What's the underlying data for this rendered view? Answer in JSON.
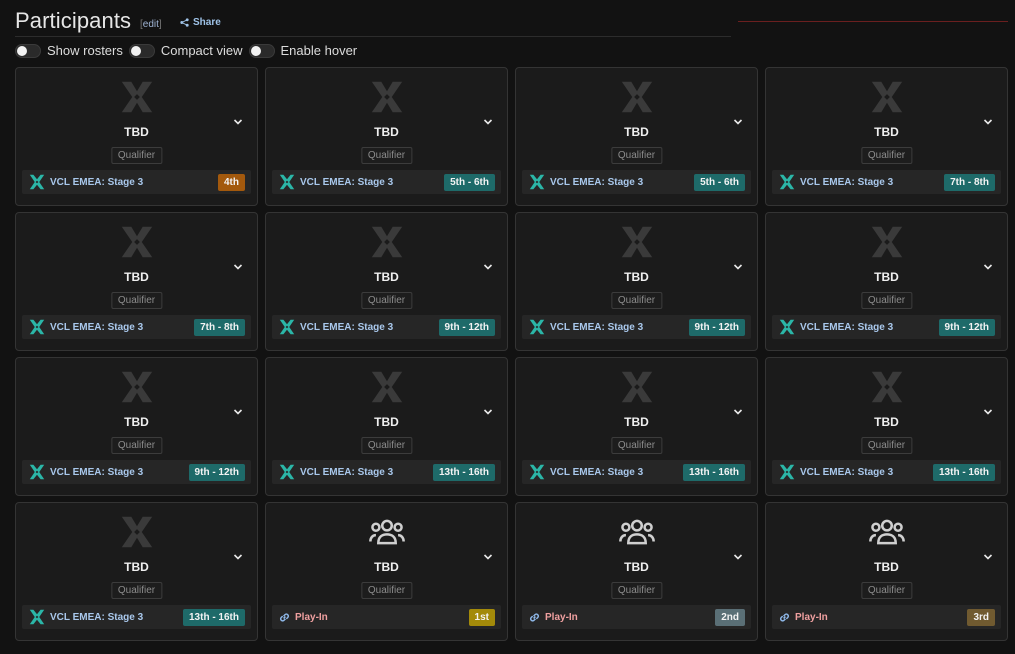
{
  "header": {
    "title": "Participants",
    "edit_label": "edit",
    "share_label": "Share"
  },
  "toggles": [
    {
      "label": "Show rosters"
    },
    {
      "label": "Compact view"
    },
    {
      "label": "Enable hover"
    }
  ],
  "colors": {
    "qualifier_logo": "#3a3a3a",
    "vcl_icon": "#2bb7a8",
    "place_4th": "#a3590d",
    "place_teal": "#1e6a69",
    "place_1st": "#a38a0a",
    "place_2nd": "#5a6f76",
    "place_3rd": "#705a30"
  },
  "cards": [
    {
      "name": "TBD",
      "tag": "Qualifier",
      "icon": "qualifier-logo-icon",
      "source": "VCL EMEA: Stage 3",
      "source_type": "vcl",
      "placement": "4th",
      "placement_color": "#a3590d"
    },
    {
      "name": "TBD",
      "tag": "Qualifier",
      "icon": "qualifier-logo-icon",
      "source": "VCL EMEA: Stage 3",
      "source_type": "vcl",
      "placement": "5th - 6th",
      "placement_color": "#1e6a69"
    },
    {
      "name": "TBD",
      "tag": "Qualifier",
      "icon": "qualifier-logo-icon",
      "source": "VCL EMEA: Stage 3",
      "source_type": "vcl",
      "placement": "5th - 6th",
      "placement_color": "#1e6a69"
    },
    {
      "name": "TBD",
      "tag": "Qualifier",
      "icon": "qualifier-logo-icon",
      "source": "VCL EMEA: Stage 3",
      "source_type": "vcl",
      "placement": "7th - 8th",
      "placement_color": "#1e6a69"
    },
    {
      "name": "TBD",
      "tag": "Qualifier",
      "icon": "qualifier-logo-icon",
      "source": "VCL EMEA: Stage 3",
      "source_type": "vcl",
      "placement": "7th - 8th",
      "placement_color": "#1e6a69"
    },
    {
      "name": "TBD",
      "tag": "Qualifier",
      "icon": "qualifier-logo-icon",
      "source": "VCL EMEA: Stage 3",
      "source_type": "vcl",
      "placement": "9th - 12th",
      "placement_color": "#1e6a69"
    },
    {
      "name": "TBD",
      "tag": "Qualifier",
      "icon": "qualifier-logo-icon",
      "source": "VCL EMEA: Stage 3",
      "source_type": "vcl",
      "placement": "9th - 12th",
      "placement_color": "#1e6a69"
    },
    {
      "name": "TBD",
      "tag": "Qualifier",
      "icon": "qualifier-logo-icon",
      "source": "VCL EMEA: Stage 3",
      "source_type": "vcl",
      "placement": "9th - 12th",
      "placement_color": "#1e6a69"
    },
    {
      "name": "TBD",
      "tag": "Qualifier",
      "icon": "qualifier-logo-icon",
      "source": "VCL EMEA: Stage 3",
      "source_type": "vcl",
      "placement": "9th - 12th",
      "placement_color": "#1e6a69"
    },
    {
      "name": "TBD",
      "tag": "Qualifier",
      "icon": "qualifier-logo-icon",
      "source": "VCL EMEA: Stage 3",
      "source_type": "vcl",
      "placement": "13th - 16th",
      "placement_color": "#1e6a69"
    },
    {
      "name": "TBD",
      "tag": "Qualifier",
      "icon": "qualifier-logo-icon",
      "source": "VCL EMEA: Stage 3",
      "source_type": "vcl",
      "placement": "13th - 16th",
      "placement_color": "#1e6a69"
    },
    {
      "name": "TBD",
      "tag": "Qualifier",
      "icon": "qualifier-logo-icon",
      "source": "VCL EMEA: Stage 3",
      "source_type": "vcl",
      "placement": "13th - 16th",
      "placement_color": "#1e6a69"
    },
    {
      "name": "TBD",
      "tag": "Qualifier",
      "icon": "qualifier-logo-icon",
      "source": "VCL EMEA: Stage 3",
      "source_type": "vcl",
      "placement": "13th - 16th",
      "placement_color": "#1e6a69"
    },
    {
      "name": "TBD",
      "tag": "Qualifier",
      "icon": "group-icon",
      "source": "Play-In",
      "source_type": "playin",
      "placement": "1st",
      "placement_color": "#a38a0a"
    },
    {
      "name": "TBD",
      "tag": "Qualifier",
      "icon": "group-icon",
      "source": "Play-In",
      "source_type": "playin",
      "placement": "2nd",
      "placement_color": "#5a6f76"
    },
    {
      "name": "TBD",
      "tag": "Qualifier",
      "icon": "group-icon",
      "source": "Play-In",
      "source_type": "playin",
      "placement": "3rd",
      "placement_color": "#705a30"
    }
  ]
}
